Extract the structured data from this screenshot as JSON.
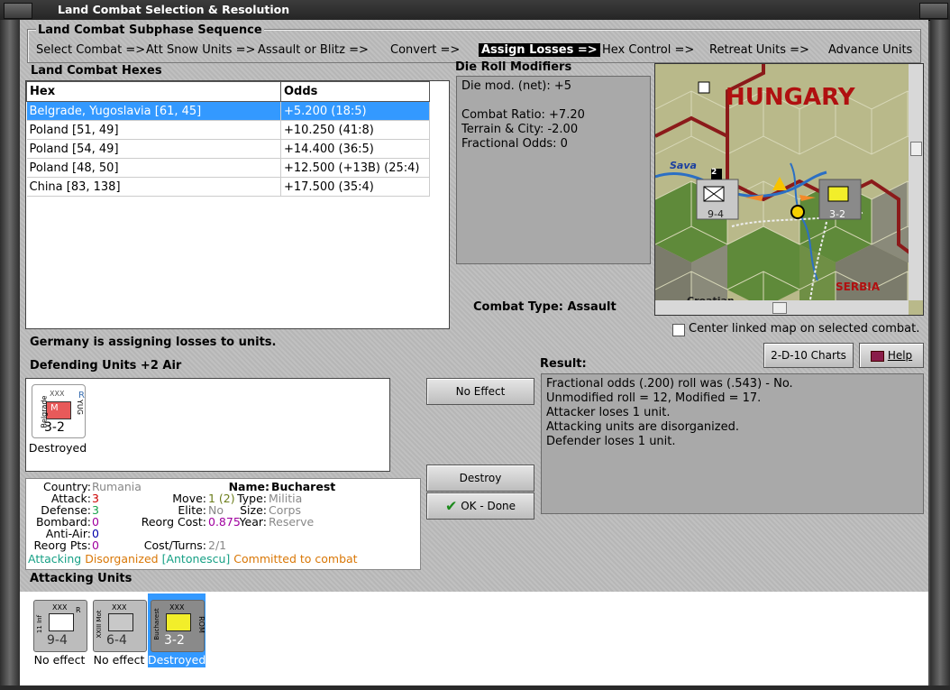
{
  "window": {
    "title": "Land Combat Selection & Resolution"
  },
  "subphase": {
    "title": "Land Combat Subphase Sequence",
    "steps": [
      "Select Combat =>",
      "Att Snow Units =>",
      "Assault or Blitz =>",
      "Convert =>",
      "Assign Losses =>",
      "Hex Control =>",
      "Retreat Units =>",
      "Advance Units"
    ],
    "active_index": 4
  },
  "hexes": {
    "title": "Land Combat Hexes",
    "col_hex": "Hex",
    "col_odds": "Odds",
    "rows": [
      {
        "hex": "Belgrade, Yugoslavia [61, 45]",
        "odds": "+5.200 (18:5)"
      },
      {
        "hex": "Poland [51, 49]",
        "odds": "+10.250 (41:8)"
      },
      {
        "hex": "Poland [54, 49]",
        "odds": "+14.400 (36:5)"
      },
      {
        "hex": "Poland [48, 50]",
        "odds": "+12.500 (+13B) (25:4)"
      },
      {
        "hex": "China [83, 138]",
        "odds": "+17.500 (35:4)"
      }
    ]
  },
  "drm": {
    "title": "Die Roll Modifiers",
    "net": "Die mod. (net): +5",
    "ratio": "Combat Ratio: +7.20",
    "terrain": "Terrain & City: -2.00",
    "fractional": "Fractional Odds: 0"
  },
  "combat_type": "Combat Type:  Assault",
  "map": {
    "country": "HUNGARY",
    "river": "Sava",
    "region": "SERBIA",
    "region2": "Croatian",
    "unit_a_value": "9-4",
    "unit_b_value": "3-2",
    "stack_badge": "2",
    "center_label": "Center linked map on selected combat."
  },
  "status": "Germany is assigning losses to units.",
  "defending": {
    "title": "Defending Units +2 Air",
    "unit": {
      "name": "Belgrade",
      "nation": "YUG",
      "size": "XXX",
      "flag": "R",
      "value": "3-2",
      "type": "M",
      "status": "Destroyed"
    }
  },
  "buttons": {
    "no_effect": "No Effect",
    "destroy": "Destroy",
    "ok_done": "OK - Done",
    "charts": "2-D-10 Charts",
    "help": "Help"
  },
  "result": {
    "title": "Result:",
    "lines": [
      "Fractional odds (.200) roll was (.543)  - No.",
      "Unmodified roll = 12, Modified = 17.",
      "Attacker loses 1 unit.",
      "Attacking units are disorganized.",
      "Defender loses 1 unit."
    ]
  },
  "details": {
    "country_label": "Country:",
    "country": "Rumania",
    "attack_label": "Attack:",
    "attack": "3",
    "defense_label": "Defense:",
    "defense": "3",
    "bombard_label": "Bombard:",
    "bombard": "0",
    "antiair_label": "Anti-Air:",
    "antiair": "0",
    "reorg_label": "Reorg Pts:",
    "reorg": "0",
    "name_label": "Name:",
    "name": "Bucharest",
    "move_label": "Move:",
    "move": "1 (2)",
    "elite_label": "Elite:",
    "elite": "No",
    "reorg_cost_label": "Reorg Cost:",
    "reorg_cost": "0.875",
    "cost_turns_label": "Cost/Turns:",
    "cost_turns": "2/1",
    "type_label": "Type:",
    "type": "Militia",
    "size_label": "Size:",
    "size": "Corps",
    "year_label": "Year:",
    "year": "Reserve",
    "status_attacking": "Attacking",
    "status_disorganized": "Disorganized",
    "status_leader": "[Antonescu]",
    "status_committed": "Committed to combat"
  },
  "attacking": {
    "title": "Attacking Units",
    "units": [
      {
        "name": "11 Inf",
        "size": "XXX",
        "flag": "R",
        "value": "9-4",
        "status": "No effect",
        "selected": false
      },
      {
        "name": "XXIII Mot",
        "size": "XXX",
        "flag": "",
        "value": "6-4",
        "status": "No effect",
        "selected": false
      },
      {
        "name": "Bucharest",
        "size": "XXX",
        "flag": "ROM",
        "value": "3-2",
        "status": "Destroyed",
        "selected": true
      }
    ]
  },
  "colors": {
    "selection": "#3399ff",
    "hex_border": "#8b1a1a",
    "country_text": "#b01010"
  }
}
